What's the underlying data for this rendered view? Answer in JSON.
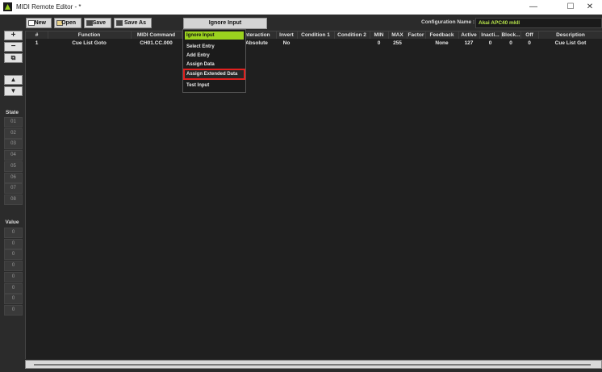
{
  "window": {
    "title": "MIDI Remote Editor - *",
    "minimize": "—",
    "maximize": "☐",
    "close": "✕"
  },
  "toolbar": {
    "new": "New",
    "open": "Open",
    "save": "Save",
    "save_as": "Save As",
    "input_mode": "Ignore Input",
    "config_label": "Configuration Name :",
    "config_value": "Akai APC40 mkII"
  },
  "sidebar": {
    "add": "+",
    "remove": "−",
    "copy": "⧉",
    "up": "▲",
    "down": "▼",
    "state_label": "State",
    "states": [
      "01",
      "02",
      "03",
      "04",
      "05",
      "06",
      "07",
      "08"
    ],
    "value_label": "Value",
    "values": [
      "0",
      "0",
      "0",
      "0",
      "0",
      "0",
      "0",
      "0"
    ]
  },
  "table": {
    "columns": [
      "#",
      "Function",
      "MIDI Command",
      "",
      "Interaction",
      "Invert",
      "Condition 1",
      "Condition 2",
      "MIN",
      "MAX",
      "Factor",
      "Feedback",
      "Active",
      "Inacti...",
      "Block...",
      "Off",
      "Description"
    ],
    "rows": [
      [
        "1",
        "Cue List Goto",
        "CH01.CC.000",
        "",
        "Absolute",
        "No",
        "",
        "",
        "0",
        "255",
        "",
        "None",
        "127",
        "0",
        "0",
        "0",
        "Cue List Got"
      ]
    ]
  },
  "dropdown_menu": {
    "items": [
      "Ignore Input",
      "Select Entry",
      "Add Entry",
      "Assign Data",
      "Assign Extended Data",
      "Test Input"
    ],
    "selected": "Ignore Input",
    "highlighted": "Assign Extended Data"
  },
  "colors": {
    "accent": "#9bd21e",
    "highlight_border": "#e0211f",
    "config_text": "#b6e34a",
    "background": "#2b2b2b"
  }
}
